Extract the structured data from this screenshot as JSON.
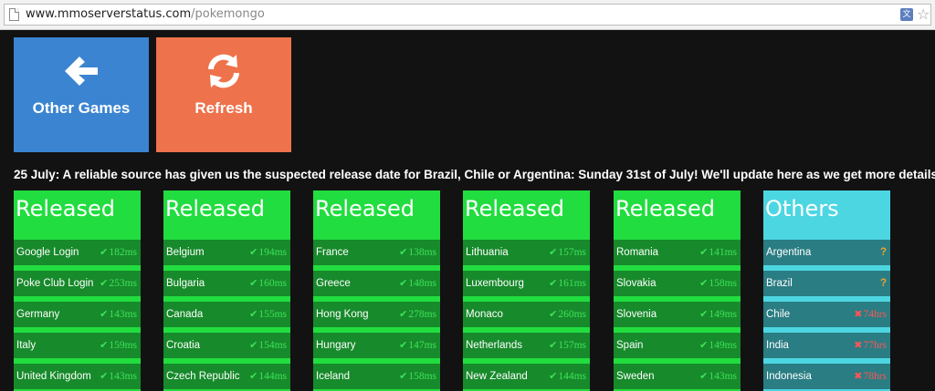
{
  "browser": {
    "url_host": "www.mmoserverstatus.com",
    "url_path": "/pokemongo",
    "translate_icon": "translate-icon",
    "bookmark_icon": "star-icon"
  },
  "tiles": {
    "back": {
      "label": "Other Games",
      "icon": "arrow-left-icon",
      "color": "#3a84d1"
    },
    "refresh": {
      "label": "Refresh",
      "icon": "refresh-icon",
      "color": "#ee724b"
    }
  },
  "announcement": "25 July: A reliable source has given us the suspected release date for Brazil, Chile or Argentina: Sunday 31st of July! We'll update here as we get more details.",
  "colors": {
    "released": "#21dd3f",
    "released_row": "#178a2b",
    "others": "#4cd6e2",
    "others_row": "#2a7d83",
    "ok": "#3ee35a",
    "down": "#ff5555",
    "unknown": "#f0a030"
  },
  "columns": [
    {
      "title": "Released",
      "rows": [
        {
          "name": "Google Login",
          "status": "ok",
          "value": "182ms"
        },
        {
          "name": "Poke Club Login",
          "status": "ok",
          "value": "253ms"
        },
        {
          "name": "Germany",
          "status": "ok",
          "value": "143ms"
        },
        {
          "name": "Italy",
          "status": "ok",
          "value": "159ms"
        },
        {
          "name": "United Kingdom",
          "status": "ok",
          "value": "143ms"
        }
      ]
    },
    {
      "title": "Released",
      "rows": [
        {
          "name": "Belgium",
          "status": "ok",
          "value": "194ms"
        },
        {
          "name": "Bulgaria",
          "status": "ok",
          "value": "160ms"
        },
        {
          "name": "Canada",
          "status": "ok",
          "value": "155ms"
        },
        {
          "name": "Croatia",
          "status": "ok",
          "value": "154ms"
        },
        {
          "name": "Czech Republic",
          "status": "ok",
          "value": "144ms"
        }
      ]
    },
    {
      "title": "Released",
      "rows": [
        {
          "name": "France",
          "status": "ok",
          "value": "138ms"
        },
        {
          "name": "Greece",
          "status": "ok",
          "value": "148ms"
        },
        {
          "name": "Hong Kong",
          "status": "ok",
          "value": "278ms"
        },
        {
          "name": "Hungary",
          "status": "ok",
          "value": "147ms"
        },
        {
          "name": "Iceland",
          "status": "ok",
          "value": "158ms"
        }
      ]
    },
    {
      "title": "Released",
      "rows": [
        {
          "name": "Lithuania",
          "status": "ok",
          "value": "157ms"
        },
        {
          "name": "Luxembourg",
          "status": "ok",
          "value": "161ms"
        },
        {
          "name": "Monaco",
          "status": "ok",
          "value": "260ms"
        },
        {
          "name": "Netherlands",
          "status": "ok",
          "value": "157ms"
        },
        {
          "name": "New Zealand",
          "status": "ok",
          "value": "144ms"
        }
      ]
    },
    {
      "title": "Released",
      "rows": [
        {
          "name": "Romania",
          "status": "ok",
          "value": "141ms"
        },
        {
          "name": "Slovakia",
          "status": "ok",
          "value": "158ms"
        },
        {
          "name": "Slovenia",
          "status": "ok",
          "value": "149ms"
        },
        {
          "name": "Spain",
          "status": "ok",
          "value": "149ms"
        },
        {
          "name": "Sweden",
          "status": "ok",
          "value": "143ms"
        }
      ]
    },
    {
      "title": "Others",
      "rows": [
        {
          "name": "Argentina",
          "status": "unknown",
          "value": "?"
        },
        {
          "name": "Brazil",
          "status": "unknown",
          "value": "?"
        },
        {
          "name": "Chile",
          "status": "down",
          "value": "74hrs"
        },
        {
          "name": "India",
          "status": "down",
          "value": "77hrs"
        },
        {
          "name": "Indonesia",
          "status": "down",
          "value": "78hrs"
        }
      ]
    }
  ]
}
